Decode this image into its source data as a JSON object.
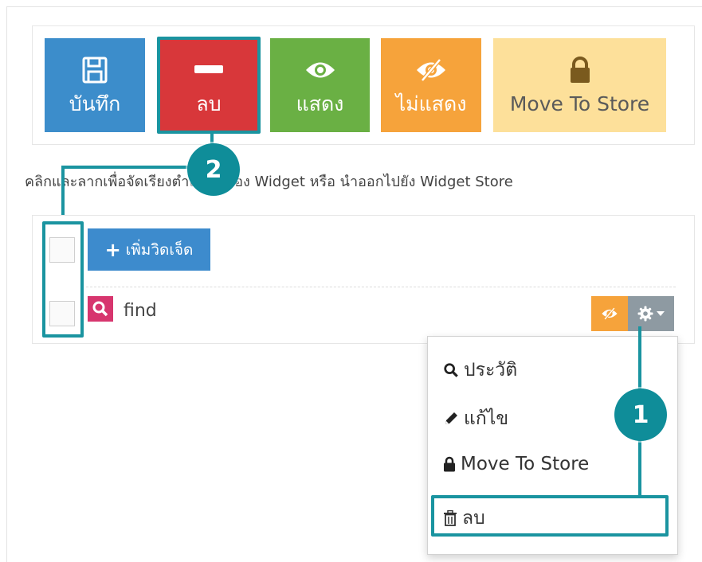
{
  "toolbar": {
    "save_label": "บันทึก",
    "delete_label": "ลบ",
    "show_label": "แสดง",
    "hide_label": "ไม่แสดง",
    "move_label": "Move To Store"
  },
  "hint": {
    "text": "คลิกและลากเพื่อจัดเรียงตำแหน่งของ Widget หรือ นำออกไปยัง Widget Store"
  },
  "widgets": {
    "add_label": "เพิ่มวิดเจ็ด",
    "items": [
      {
        "label": "find"
      }
    ]
  },
  "menu": {
    "items": [
      {
        "label": "ประวัติ",
        "icon": "search-icon"
      },
      {
        "label": "แก้ไข",
        "icon": "pencil-icon"
      },
      {
        "label": "Move To Store",
        "icon": "lock-icon"
      },
      {
        "label": "ลบ",
        "icon": "trash-icon"
      }
    ]
  },
  "callouts": {
    "first": "1",
    "second": "2"
  },
  "colors": {
    "save": "#3c8dcb",
    "delete": "#d8373a",
    "show": "#6ab044",
    "hide": "#f6a33b",
    "move": "#fde09a",
    "annotation": "#1a94a0"
  }
}
